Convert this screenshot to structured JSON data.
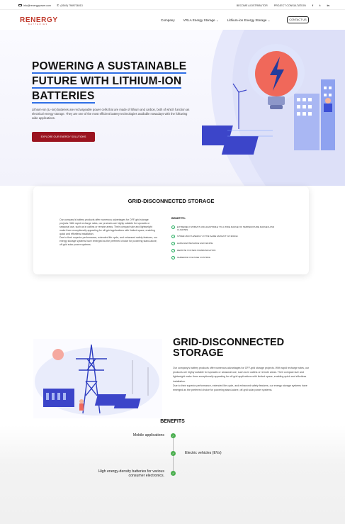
{
  "topbar": {
    "email": "info@renergypower.com",
    "phone": "(0549) 7989726013",
    "links": [
      "BECOME A DISTRIBUTOR",
      "PROJECT CONSULTATION"
    ],
    "social": [
      "f",
      "t",
      "in"
    ]
  },
  "nav": {
    "logo": "RENERGY",
    "logo_sub": "BATTERIES",
    "items": [
      "Company",
      "VRLA Energy Storage ⌄",
      "Lithium-ion Energy Storage ⌄"
    ],
    "contact": "CONTACT US"
  },
  "hero": {
    "title_lines": [
      "POWERING A SUSTAINABLE",
      "FUTURE WITH LITHIUM-ION",
      "BATTERIES"
    ],
    "description": "Lithium-ion (Li-ion) batteries are rechargeable power cells that are made of lithium and carbon, both of which function as electrical energy storage. They are one of the most efficient battery technologies available nowadays with the following wide applications.",
    "button": "EXPLORE OUR ENERGY SOLUTIONS"
  },
  "card": {
    "title": "GRID-DISCONNECTED STORAGE",
    "desc_p1": "Our company's battery products offer numerous advantages for OFF-grid storage projects. With rapid recharge rates, our products are highly suitable for sporadic or seasonal use, such as in cabins or remote areas. Their compact size and lightweight make them exceptionally appealing for off-grid applications with limited space, enabling quick and effortless installation.",
    "desc_p2": "Due to their superior performance, extended life cycle, and enhanced safety features, our energy storage systems have emerged as the preferred choice for powering stand-alone, off-grid solar power systems.",
    "benefits_heading": "BENEFITS:",
    "benefits": [
      "EXTREMELY ROBUST AND ADAPTABLE TO A WIDE RANGE OF TEMPERATURE RANGES AND CLIMATES.",
      "STORE MUCH ENERGY IN THE SAME AMOUNT OF SPACE.",
      "LESS MAINTENANCE AND WASTE.",
      "REMOTE SYSTEM COMMUNICATION.",
      "SUPERIOR VOLTAGE CONTROL."
    ]
  },
  "section2": {
    "title": "GRID-DISCONNECTED STORAGE",
    "desc_p1": "Our company's battery products offer numerous advantages for OFF-grid storage projects. With rapid recharge rates, our products are highly suitable for sporadic or seasonal use, such as in cabins or remote areas. Their compact size and lightweight make them exceptionally appealing for off-grid applications with limited space, enabling quick and effortless installation.",
    "desc_p2": "Due to their superior performance, extended life cycle, and enhanced safety features, our energy storage systems have emerged as the preferred choice for powering stand-alone, off-grid solar power systems."
  },
  "benefits_section": {
    "title": "BENEFITS",
    "items": [
      {
        "text": "Mobile applications",
        "side": "left"
      },
      {
        "text": "Electric vehicles (EVs)",
        "side": "right"
      },
      {
        "text": "High energy-density batteries for various consumer electronics.",
        "side": "left"
      }
    ]
  },
  "colors": {
    "accent_blue": "#2f6fe6",
    "button_red": "#9b1420",
    "check_green": "#4caf50"
  }
}
